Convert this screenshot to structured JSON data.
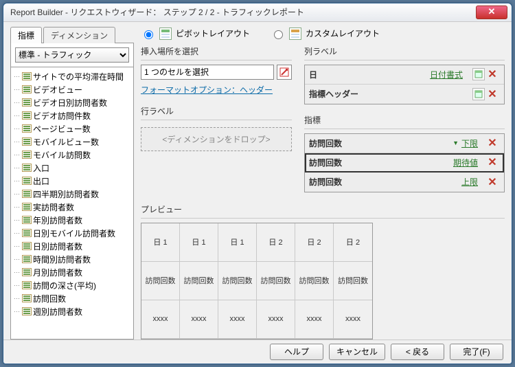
{
  "window": {
    "title": "Report Builder - リクエストウィザード：  ステップ 2 / 2  - トラフィックレポート"
  },
  "tabs": {
    "metrics": "指標",
    "dimensions": "ディメンション"
  },
  "dropdown": {
    "selected": "標準 - トラフィック"
  },
  "tree": [
    "サイトでの平均滞在時間",
    "ビデオビュー",
    "ビデオ日別訪問者数",
    "ビデオ訪問件数",
    "ページビュー数",
    "モバイルビュー数",
    "モバイル訪問数",
    "入口",
    "出口",
    "四半期別訪問者数",
    "実訪問者数",
    "年別訪問者数",
    "日別モバイル訪問者数",
    "日別訪問者数",
    "時間別訪問者数",
    "月別訪問者数",
    "訪問の深さ(平均)",
    "訪問回数",
    "週別訪問者数"
  ],
  "layout": {
    "pivot": "ピボットレイアウト",
    "custom": "カスタムレイアウト"
  },
  "insert": {
    "group": "挿入場所を選択",
    "value": "1 つのセルを選択",
    "format_link": "フォーマットオプション：ヘッダー"
  },
  "rowlabel": {
    "group": "行ラベル",
    "drop": "<ディメンションをドロップ>"
  },
  "collabel": {
    "group": "列ラベル",
    "rows": [
      {
        "name": "日",
        "link": "日付書式"
      },
      {
        "name": "指標ヘッダー",
        "link": ""
      }
    ]
  },
  "metrics": {
    "group": "指標",
    "rows": [
      {
        "name": "訪問回数",
        "link": "下限",
        "tri": true,
        "selected": false
      },
      {
        "name": "訪問回数",
        "link": "期待値",
        "tri": false,
        "selected": true
      },
      {
        "name": "訪問回数",
        "link": "上限",
        "tri": false,
        "selected": false
      }
    ]
  },
  "preview": {
    "group": "プレビュー",
    "headers": [
      "日 1",
      "日 1",
      "日 1",
      "日 2",
      "日 2",
      "日 2"
    ],
    "row2": [
      "訪問回数",
      "訪問回数",
      "訪問回数",
      "訪問回数",
      "訪問回数",
      "訪問回数"
    ],
    "row3": [
      "xxxx",
      "xxxx",
      "xxxx",
      "xxxx",
      "xxxx",
      "xxxx"
    ]
  },
  "footer": {
    "help": "ヘルプ",
    "cancel": "キャンセル",
    "back": "< 戻る",
    "finish": "完了(F)"
  }
}
